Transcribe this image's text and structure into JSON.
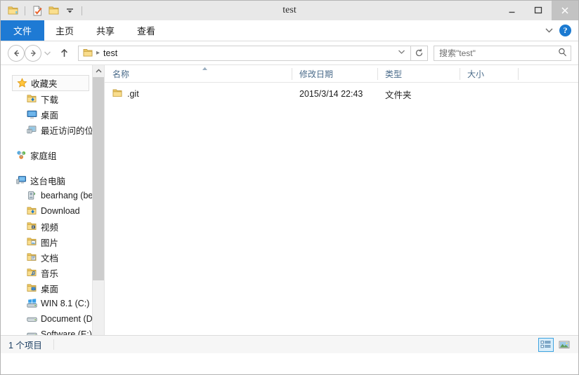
{
  "window": {
    "title": "test",
    "controls": {
      "minimize": "minimize-button",
      "maximize": "maximize-button",
      "close": "close-button"
    }
  },
  "quick_access_toolbar": {
    "items": [
      {
        "name": "folder-icon",
        "tooltip": ""
      },
      {
        "name": "properties-icon",
        "tooltip": ""
      },
      {
        "name": "new-folder-icon",
        "tooltip": ""
      },
      {
        "name": "chevron-down-icon",
        "tooltip": ""
      }
    ]
  },
  "ribbon": {
    "tabs": [
      {
        "id": "file",
        "label": "文件",
        "active": true
      },
      {
        "id": "home",
        "label": "主页",
        "active": false
      },
      {
        "id": "share",
        "label": "共享",
        "active": false
      },
      {
        "id": "view",
        "label": "查看",
        "active": false
      }
    ],
    "expand_icon": "chevron-down-icon",
    "help_label": "?",
    "accent_color": "#1e7ad4"
  },
  "address_bar": {
    "back_icon": "back-arrow-icon",
    "forward_icon": "forward-arrow-icon",
    "history_icon": "chevron-down-icon",
    "up_icon": "up-arrow-icon",
    "breadcrumb": {
      "folder_icon": "folder-icon",
      "separator": "▸",
      "path": "test"
    },
    "dropdown_icon": "chevron-down-icon",
    "refresh_icon": "refresh-icon"
  },
  "search": {
    "placeholder": "搜索\"test\"",
    "value": "",
    "icon": "search-icon"
  },
  "nav_pane": {
    "groups": [
      {
        "root": {
          "label": "收藏夹",
          "icon": "star-icon",
          "selected": true
        },
        "children": [
          {
            "label": "下载",
            "icon": "download-folder-icon"
          },
          {
            "label": "桌面",
            "icon": "desktop-icon"
          },
          {
            "label": "最近访问的位置",
            "icon": "recent-places-icon"
          }
        ]
      },
      {
        "root": {
          "label": "家庭组",
          "icon": "homegroup-icon",
          "selected": false
        },
        "children": []
      },
      {
        "root": {
          "label": "这台电脑",
          "icon": "this-pc-icon",
          "selected": false
        },
        "children": [
          {
            "label": "bearhang (bear",
            "icon": "user-folder-icon"
          },
          {
            "label": "Download",
            "icon": "download-folder-icon"
          },
          {
            "label": "视频",
            "icon": "videos-folder-icon"
          },
          {
            "label": "图片",
            "icon": "pictures-folder-icon"
          },
          {
            "label": "文档",
            "icon": "documents-folder-icon"
          },
          {
            "label": "音乐",
            "icon": "music-folder-icon"
          },
          {
            "label": "桌面",
            "icon": "desktop-folder-icon"
          },
          {
            "label": "WIN 8.1 (C:)",
            "icon": "windows-drive-icon"
          },
          {
            "label": "Document (D:)",
            "icon": "drive-icon"
          },
          {
            "label": "Software (E:)",
            "icon": "drive-icon"
          }
        ]
      }
    ],
    "scrollbar": {
      "up_icon": "chevron-up-icon",
      "down_icon": "chevron-down-icon"
    }
  },
  "file_list": {
    "columns": [
      {
        "id": "name",
        "label": "名称",
        "sorted": "asc"
      },
      {
        "id": "date",
        "label": "修改日期",
        "sorted": ""
      },
      {
        "id": "type",
        "label": "类型",
        "sorted": ""
      },
      {
        "id": "size",
        "label": "大小",
        "sorted": ""
      }
    ],
    "sort_caret": "▲",
    "rows": [
      {
        "icon": "folder-icon",
        "name": ".git",
        "date": "2015/3/14 22:43",
        "type": "文件夹",
        "size": ""
      }
    ]
  },
  "status_bar": {
    "item_count": "1 个项目",
    "views": [
      {
        "id": "details",
        "icon": "details-view-icon",
        "active": true
      },
      {
        "id": "large-icons",
        "icon": "large-icons-view-icon",
        "active": false
      }
    ]
  }
}
